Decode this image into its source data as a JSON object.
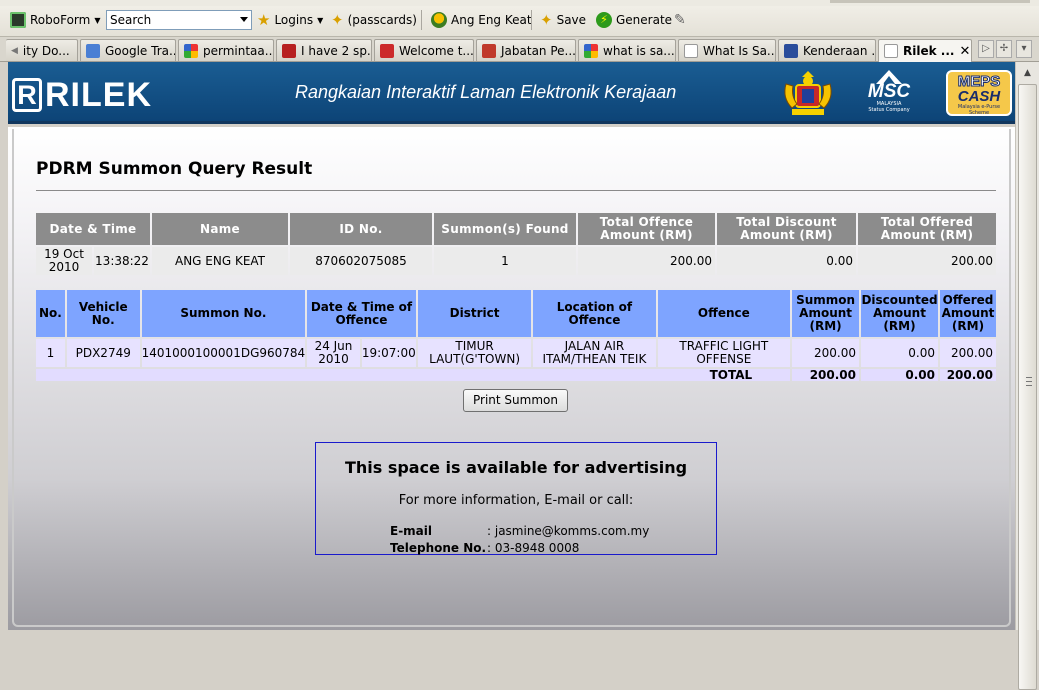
{
  "toolbar": {
    "roboform": "RoboForm",
    "search_value": "Search",
    "logins": "Logins",
    "passcards": "(passcards)",
    "user": "Ang Eng Keat",
    "save": "Save",
    "generate": "Generate"
  },
  "tabs": [
    {
      "label": "ity Do...",
      "icon": "page-icon"
    },
    {
      "label": "Google Tra...",
      "icon": "google-translate-icon"
    },
    {
      "label": "permintaa...",
      "icon": "google-icon"
    },
    {
      "label": "I have 2 sp...",
      "icon": "forum-icon"
    },
    {
      "label": "Welcome t...",
      "icon": "site-icon"
    },
    {
      "label": "Jabatan Pe...",
      "icon": "site-icon"
    },
    {
      "label": "what is sa...",
      "icon": "google-icon"
    },
    {
      "label": "What Is Sa...",
      "icon": "page-icon"
    },
    {
      "label": "Kenderaan ...",
      "icon": "site-icon"
    },
    {
      "label": "Rilek ...",
      "icon": "page-icon",
      "active": true
    }
  ],
  "header": {
    "logo_letter": "R",
    "logo_word": "RILEK",
    "tagline": "Rangkaian Interaktif Laman Elektronik Kerajaan",
    "msc": "MSC",
    "msc_sub1": "MALAYSIA",
    "msc_sub2": "Status Company",
    "meps1": "MEPS",
    "meps2": "CASH",
    "meps_sub": "Malaysia e-Purse Scheme"
  },
  "page": {
    "title": "PDRM Summon Query Result"
  },
  "summary": {
    "headers": [
      "Date & Time",
      "Name",
      "ID No.",
      "Summon(s) Found",
      "Total Offence Amount (RM)",
      "Total Discount Amount (RM)",
      "Total Offered Amount (RM)"
    ],
    "row": {
      "date": "19 Oct 2010",
      "time": "13:38:22",
      "name": "ANG ENG KEAT",
      "id_no": "870602075085",
      "found": "1",
      "offence_amount": "200.00",
      "discount_amount": "0.00",
      "offered_amount": "200.00"
    }
  },
  "detail": {
    "headers": [
      "No.",
      "Vehicle No.",
      "Summon No.",
      "Date & Time of Offence",
      "District",
      "Location of Offence",
      "Offence",
      "Summon Amount (RM)",
      "Discounted Amount (RM)",
      "Offered Amount (RM)"
    ],
    "rows": [
      {
        "no": "1",
        "vehicle": "PDX2749",
        "summon_no": "1401000100001DG960784",
        "date": "24 Jun 2010",
        "time": "19:07:00",
        "district": "TIMUR LAUT(G'TOWN)",
        "location": "JALAN AIR ITAM/THEAN TEIK",
        "offence": "TRAFFIC LIGHT OFFENSE",
        "summon_amount": "200.00",
        "discounted_amount": "0.00",
        "offered_amount": "200.00"
      }
    ],
    "total_label": "TOTAL",
    "total_summon": "200.00",
    "total_discounted": "0.00",
    "total_offered": "200.00"
  },
  "print_button": "Print Summon",
  "ad": {
    "title": "This space is available for advertising",
    "subtitle": "For more information, E-mail or call:",
    "email_label": "E-mail",
    "email_value": ": jasmine@komms.com.my",
    "phone_label": "Telephone No.",
    "phone_value": ": 03-8948 0008"
  },
  "colors": {
    "header_blue": "#0d4477",
    "summary_header": "#8c8c8c",
    "detail_header": "#7ea4ff",
    "detail_row": "#e7e2ff",
    "ad_border": "#1a1acc"
  }
}
